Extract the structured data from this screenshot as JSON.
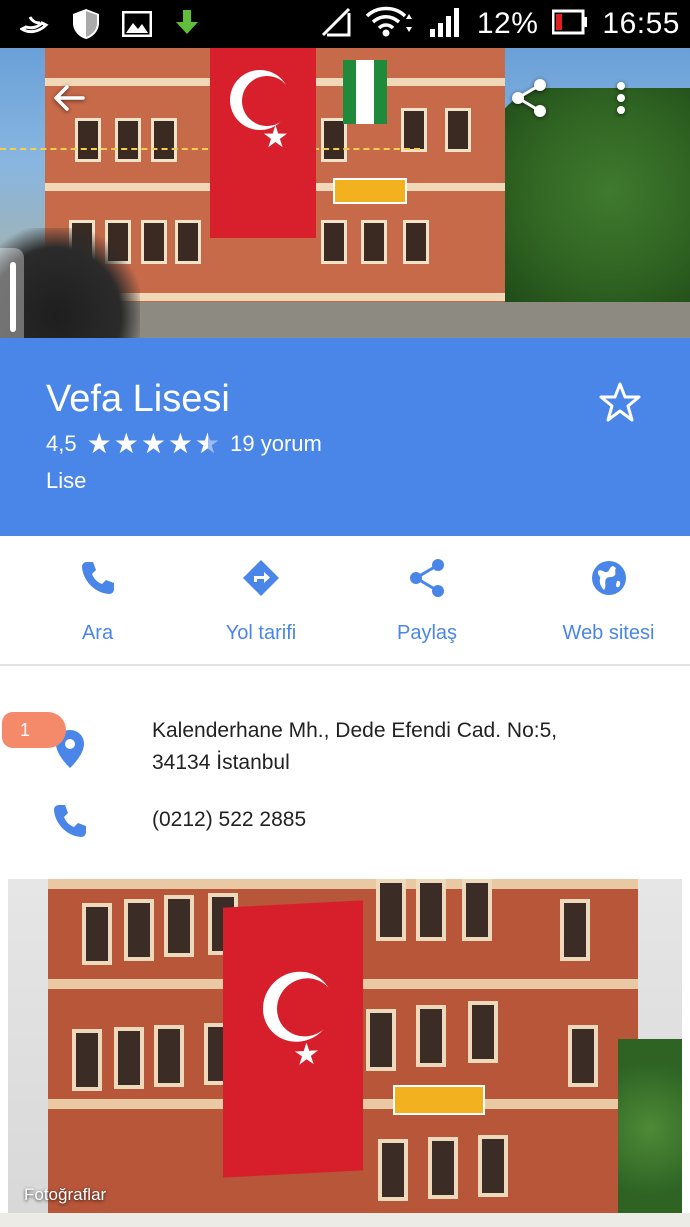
{
  "status_bar": {
    "icons_left": [
      "bird-icon",
      "shield-icon",
      "image-icon",
      "download-icon"
    ],
    "icons_right": [
      "no-signal-icon",
      "wifi-icon",
      "cell-signal-icon",
      "battery-icon"
    ],
    "battery": "12%",
    "time": "16:55"
  },
  "toolbar": {
    "back_icon": "arrow-back-icon",
    "share_icon": "share-icon",
    "more_icon": "more-vert-icon"
  },
  "place": {
    "name": "Vefa Lisesi",
    "rating": "4,5",
    "rating_stars": 4.5,
    "reviews": "19 yorum",
    "category": "Lise"
  },
  "actions": [
    {
      "label": "Ara",
      "icon": "phone-icon"
    },
    {
      "label": "Yol tarifi",
      "icon": "directions-icon"
    },
    {
      "label": "Paylaş",
      "icon": "share-icon"
    },
    {
      "label": "Web sitesi",
      "icon": "globe-icon"
    }
  ],
  "info": {
    "badge": "1",
    "address_line1": "Kalenderhane Mh., Dede Efendi Cad. No:5,",
    "address_line2": "34134 İstanbul",
    "phone": "(0212) 522 2885"
  },
  "photos": {
    "caption": "Fotoğraflar"
  },
  "colors": {
    "accent": "#4a86e8",
    "badge": "#f58a6a"
  }
}
